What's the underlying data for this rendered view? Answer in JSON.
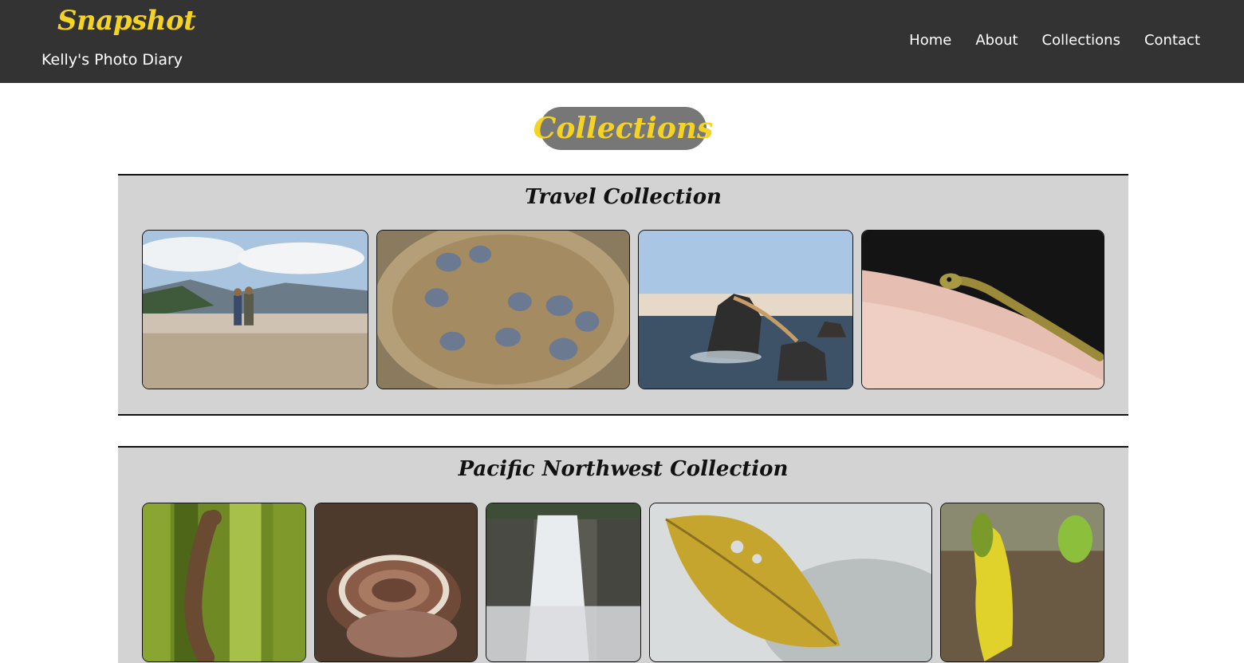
{
  "header": {
    "brand_title": "Snapshot",
    "brand_subtitle": "Kelly's Photo Diary",
    "nav": [
      {
        "label": "Home"
      },
      {
        "label": "About"
      },
      {
        "label": "Collections"
      },
      {
        "label": "Contact"
      }
    ]
  },
  "page_title": "Collections",
  "collections": [
    {
      "title": "Travel Collection",
      "photos": [
        {
          "subject": "couple-landscape"
        },
        {
          "subject": "baby-turtles-basket"
        },
        {
          "subject": "rock-sea"
        },
        {
          "subject": "gecko-on-hand"
        }
      ]
    },
    {
      "title": "Pacific Northwest Collection",
      "photos": [
        {
          "subject": "lizard-on-leaves"
        },
        {
          "subject": "turkey-tail-fungus"
        },
        {
          "subject": "waterfall"
        },
        {
          "subject": "yellow-leaf"
        },
        {
          "subject": "skunk-cabbage"
        }
      ]
    }
  ],
  "colors": {
    "header_bg": "#333333",
    "accent": "#f5d323",
    "panel_bg": "#d3d3d3",
    "title_pill_bg": "#777777"
  }
}
